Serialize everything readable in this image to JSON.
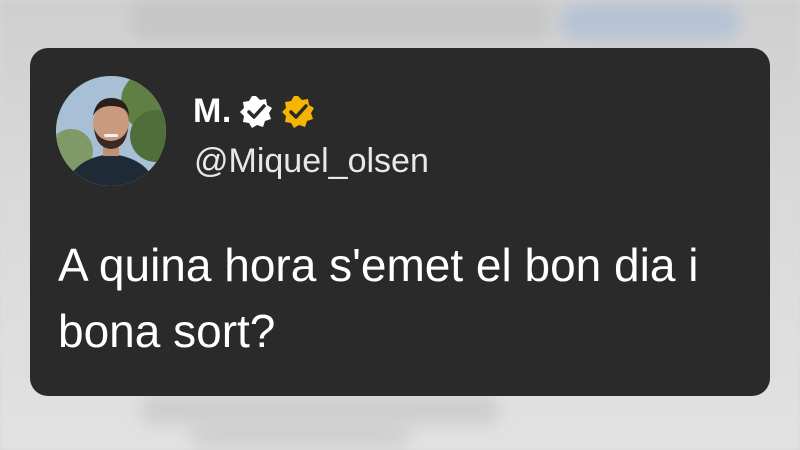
{
  "tweet": {
    "author_name": "M.",
    "author_handle": "@Miquel_olsen",
    "text": "A quina hora s'emet el bon dia i bona sort?"
  },
  "badges": {
    "first_icon": "dark-verified-badge-icon",
    "second_icon": "gold-verified-badge-icon"
  },
  "colors": {
    "card_background": "#2a2a2a",
    "text_primary": "#ffffff",
    "badge_gold": "#f4b400"
  }
}
